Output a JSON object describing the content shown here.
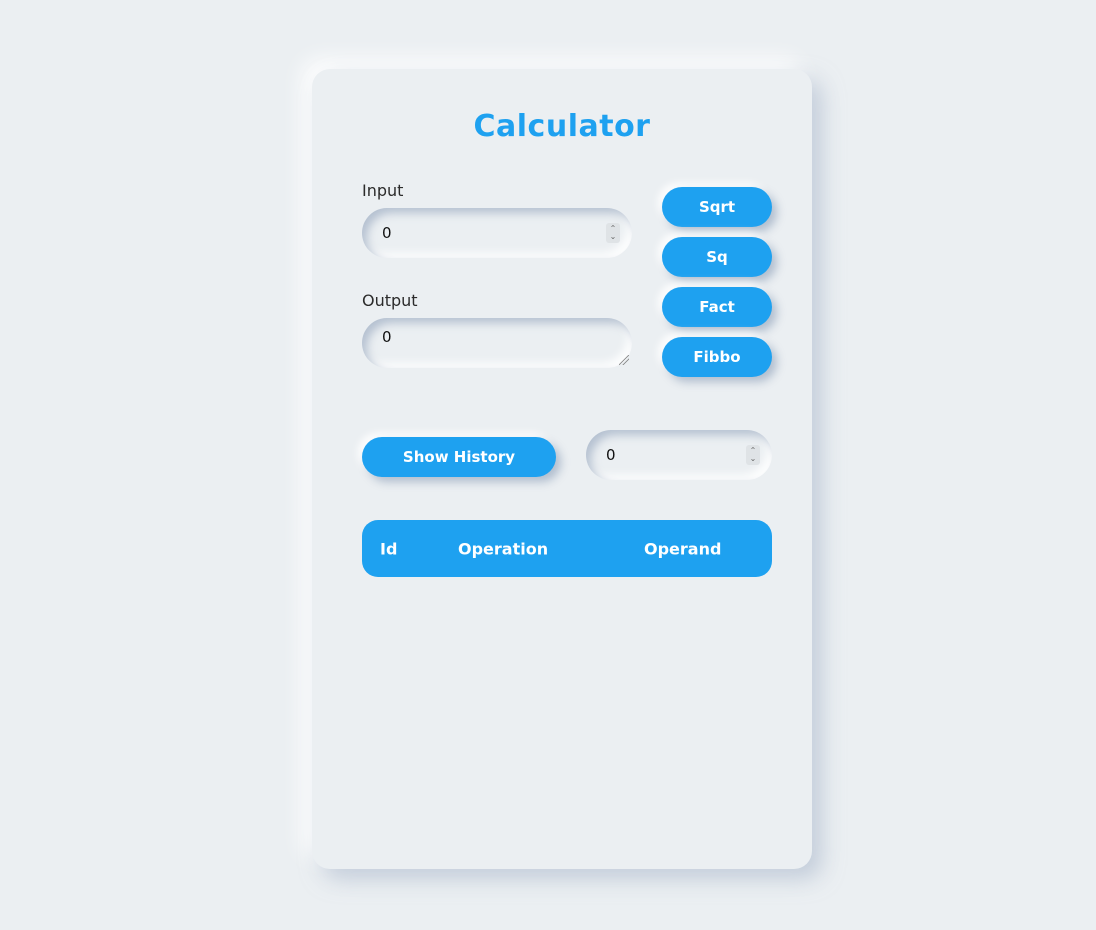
{
  "app": {
    "title": "Calculator"
  },
  "input": {
    "label": "Input",
    "value": "0"
  },
  "output": {
    "label": "Output",
    "value": "0"
  },
  "operations": {
    "sqrt": "Sqrt",
    "sq": "Sq",
    "fact": "Fact",
    "fibbo": "Fibbo"
  },
  "history": {
    "button_label": "Show History",
    "count_value": "0"
  },
  "table": {
    "columns": [
      "Id",
      "Operation",
      "Operand"
    ],
    "rows": []
  },
  "colors": {
    "accent": "#1ea1f0",
    "background": "#ebeff2"
  }
}
